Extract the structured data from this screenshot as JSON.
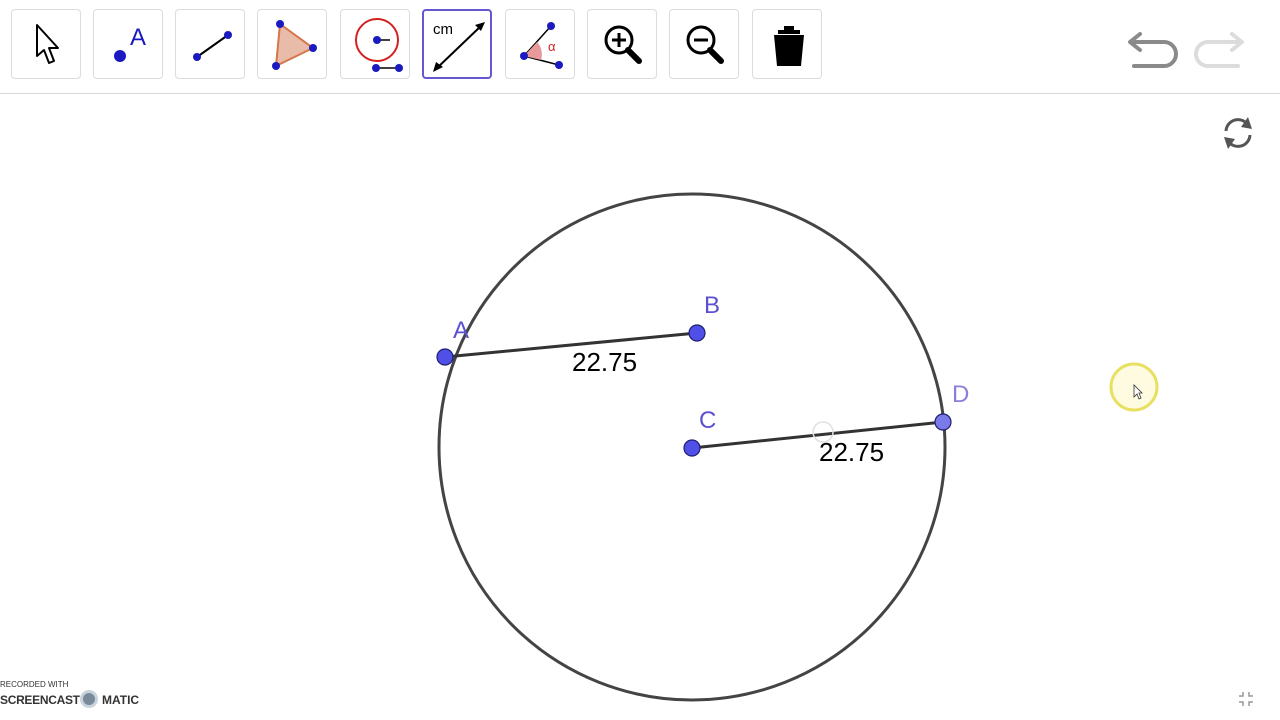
{
  "toolbar": {
    "tools": [
      {
        "name": "Move",
        "icon": "pointer-arrow-icon"
      },
      {
        "name": "Point",
        "icon": "point-icon",
        "label": "A"
      },
      {
        "name": "Segment",
        "icon": "segment-icon"
      },
      {
        "name": "Polygon",
        "icon": "polygon-icon"
      },
      {
        "name": "Circle with Center through Point",
        "icon": "circle-center-icon"
      },
      {
        "name": "Distance or Length",
        "icon": "distance-icon",
        "label": "cm",
        "selected": true
      },
      {
        "name": "Angle",
        "icon": "angle-icon",
        "label": "α"
      },
      {
        "name": "Zoom In",
        "icon": "zoom-in-icon"
      },
      {
        "name": "Zoom Out",
        "icon": "zoom-out-icon"
      },
      {
        "name": "Delete",
        "icon": "trash-icon"
      }
    ],
    "undo_icon": "undo-icon",
    "redo_icon": "redo-icon"
  },
  "canvas": {
    "points": [
      {
        "name": "A"
      },
      {
        "name": "B"
      },
      {
        "name": "C"
      },
      {
        "name": "D"
      }
    ],
    "segment_AB_length": "22.75",
    "segment_CD_length": "22.75"
  },
  "watermark": {
    "line1": "RECORDED WITH",
    "line2": "SCREENCAST",
    "line3": "MATIC"
  },
  "colors": {
    "point_fill": "#5050e8",
    "point_label": "#5a50d0",
    "segment": "#333333",
    "circle": "#444444",
    "selected_tool_border": "#6557d2"
  }
}
